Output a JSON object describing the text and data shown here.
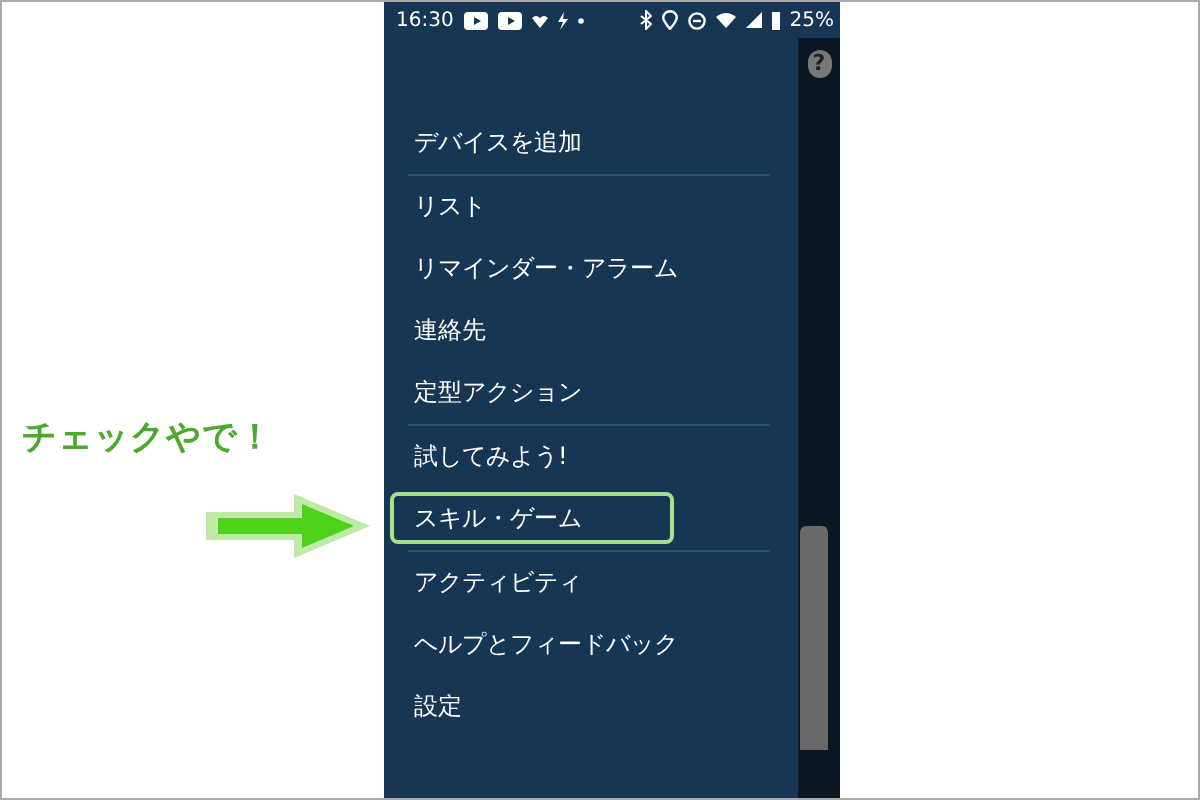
{
  "annotation": {
    "text": "チェックやで！"
  },
  "status_bar": {
    "time": "16:30",
    "battery": "25%"
  },
  "help_icon": {
    "glyph": "?"
  },
  "menu": [
    {
      "label": "デバイスを追加",
      "divider_after": true,
      "highlighted": false
    },
    {
      "label": "リスト",
      "divider_after": false,
      "highlighted": false
    },
    {
      "label": "リマインダー・アラーム",
      "divider_after": false,
      "highlighted": false
    },
    {
      "label": "連絡先",
      "divider_after": false,
      "highlighted": false
    },
    {
      "label": "定型アクション",
      "divider_after": true,
      "highlighted": false
    },
    {
      "label": "試してみよう!",
      "divider_after": false,
      "highlighted": false
    },
    {
      "label": "スキル・ゲーム",
      "divider_after": true,
      "highlighted": true
    },
    {
      "label": "アクティビティ",
      "divider_after": false,
      "highlighted": false
    },
    {
      "label": "ヘルプとフィードバック",
      "divider_after": false,
      "highlighted": false
    },
    {
      "label": "設定",
      "divider_after": false,
      "highlighted": false
    }
  ]
}
